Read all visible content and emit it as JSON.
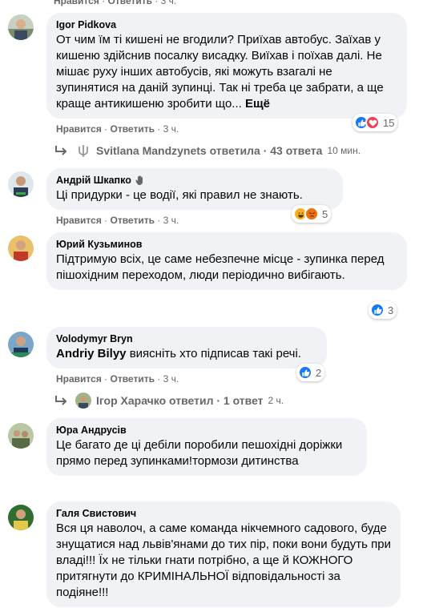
{
  "top_meta": {
    "like": "Нравится",
    "reply": "Ответить",
    "time": "3 ч."
  },
  "comments": [
    {
      "author": "Igor Pidkova",
      "text": "От чим їм ті кишені не вгодили? Приїхав автобус. Заїхав у кишеню здійснив посалку висадку. Виїхав і поїхав далі. Не мішає руху інших автобусів, які можуть взагалі не зупинятися на даній зупинці. Так ні треба це забрати, а ще краще антикишеню зробити що...",
      "more": "Ещё",
      "like": "Нравится",
      "reply": "Ответить",
      "time": "3 ч.",
      "reaction_count": "15",
      "reactions": [
        "like",
        "love"
      ]
    },
    {
      "author": "Андрій Шкапко",
      "author_icon": "waving-hand-icon",
      "text": "Ці придурки - це водії, які правил не знають.",
      "like": "Нравится",
      "reply": "Ответить",
      "time": "3 ч.",
      "reaction_count": "5",
      "reactions": [
        "haha",
        "angry"
      ]
    },
    {
      "author": "Юрий Кузьминов",
      "text": "Підтримую всіх, це саме небезпечне місце - зупинка перед пішохідним переходом, люди періодично вибігають.",
      "like": "Нравится",
      "reply": "Ответить",
      "time": "3 ч.",
      "reaction_count": "3",
      "reactions": [
        "like"
      ]
    },
    {
      "author": "Volodymyr Bryn",
      "mention": "Andriy Bilyy",
      "text": " виясніть хто підписав такі речі.",
      "like": "Нравится",
      "reply": "Ответить",
      "time": "3 ч.",
      "reaction_count": "2",
      "reactions": [
        "like"
      ]
    },
    {
      "author": "Юра Андрусів",
      "text": "Це багато де ці дебіли поробили пешохідні доріжки прямо перед зупинками!тормози дитинства"
    },
    {
      "author": "Галя Свистович",
      "text": "Вся ця наволоч, а саме команда нікчемного садового, буде знущатися над львів'янами до тих пір, поки вони будуть при владі!!! Їх не тільки гнати потрібно, а ще й КОЖНОГО притягнути до КРИМІНАЛЬНОЇ відповідальності за подіяне!!!"
    }
  ],
  "replies": [
    {
      "text": "Svitlana Mandzynets ответила · 43 ответа",
      "time": "10 мин."
    },
    {
      "text": "Ігор Харачко ответил · 1 ответ",
      "time": "2 ч."
    }
  ],
  "colors": {
    "bubble": "#f0f2f5",
    "meta": "#65676b",
    "like": "#1877f2",
    "love": "#f33e58",
    "haha": "#f7b125",
    "angry": "#e9710f"
  }
}
